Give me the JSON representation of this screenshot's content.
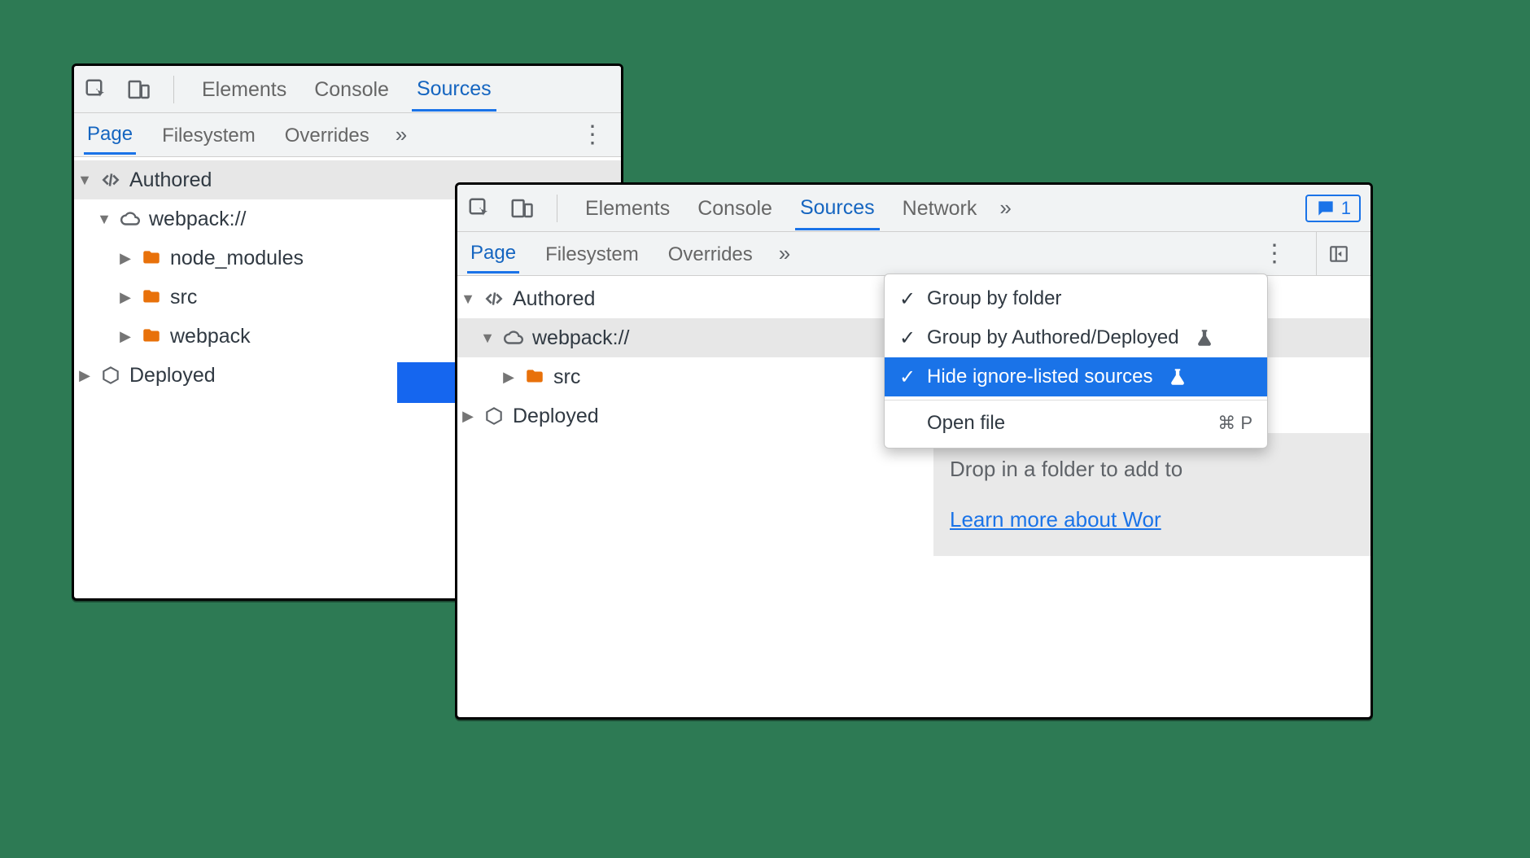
{
  "left": {
    "top_tabs": {
      "elements": "Elements",
      "console": "Console",
      "sources": "Sources"
    },
    "sub_tabs": {
      "page": "Page",
      "filesystem": "Filesystem",
      "overrides": "Overrides"
    },
    "tree": {
      "authored": "Authored",
      "webpack": "webpack://",
      "node_modules": "node_modules",
      "src": "src",
      "webpack_folder": "webpack",
      "deployed": "Deployed"
    }
  },
  "right": {
    "top_tabs": {
      "elements": "Elements",
      "console": "Console",
      "sources": "Sources",
      "network": "Network"
    },
    "feedback_count": "1",
    "sub_tabs": {
      "page": "Page",
      "filesystem": "Filesystem",
      "overrides": "Overrides"
    },
    "tree": {
      "authored": "Authored",
      "webpack": "webpack://",
      "src": "src",
      "deployed": "Deployed"
    },
    "hint": {
      "line1": "Drop in a folder to add to",
      "link": "Learn more about Wor"
    }
  },
  "menu": {
    "group_folder": "Group by folder",
    "group_authored": "Group by Authored/Deployed",
    "hide_ignore": "Hide ignore-listed sources",
    "open_file": "Open file",
    "open_file_shortcut": "⌘ P"
  }
}
